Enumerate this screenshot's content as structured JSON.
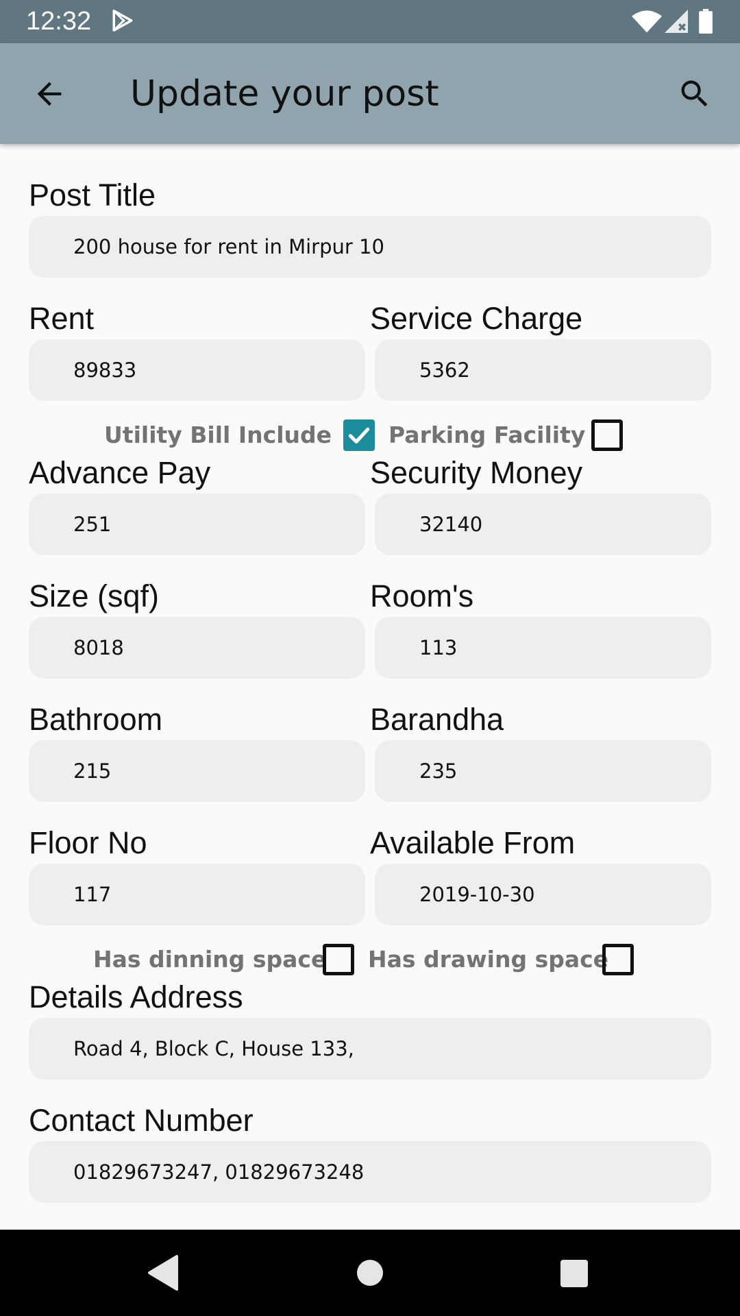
{
  "status_bar": {
    "time": "12:32"
  },
  "app_bar": {
    "title": "Update your post"
  },
  "form": {
    "post_title": {
      "label": "Post Title",
      "value": "200 house for rent in Mirpur 10"
    },
    "rent": {
      "label": "Rent",
      "value": "89833"
    },
    "service_charge": {
      "label": "Service Charge",
      "value": "5362"
    },
    "utility_bill": {
      "label": "Utility Bill Include",
      "checked": true
    },
    "parking": {
      "label": "Parking Facility",
      "checked": false
    },
    "advance_pay": {
      "label": "Advance Pay",
      "value": "251"
    },
    "security_money": {
      "label": "Security Money",
      "value": "32140"
    },
    "size": {
      "label": "Size (sqf)",
      "value": "8018"
    },
    "rooms": {
      "label": "Room's",
      "value": "113"
    },
    "bathroom": {
      "label": "Bathroom",
      "value": "215"
    },
    "barandha": {
      "label": "Barandha",
      "value": "235"
    },
    "floor_no": {
      "label": "Floor No",
      "value": "117"
    },
    "available_from": {
      "label": "Available From",
      "value": "2019-10-30"
    },
    "dinning_space": {
      "label": "Has dinning space",
      "checked": false
    },
    "drawing_space": {
      "label": "Has drawing space",
      "checked": false
    },
    "address": {
      "label": "Details Address",
      "value": "Road 4, Block C, House 133,"
    },
    "contact": {
      "label": "Contact Number",
      "value": "01829673247, 01829673248"
    }
  },
  "colors": {
    "status_bar": "#607681",
    "app_bar": "#90a4ad",
    "accent": "#1a8c9c",
    "field_bg": "#eeeeee"
  },
  "icons": [
    "play-store-icon",
    "wifi-icon",
    "signal-icon",
    "battery-icon",
    "back-arrow-icon",
    "search-icon",
    "nav-back-icon",
    "nav-home-icon",
    "nav-recents-icon"
  ]
}
